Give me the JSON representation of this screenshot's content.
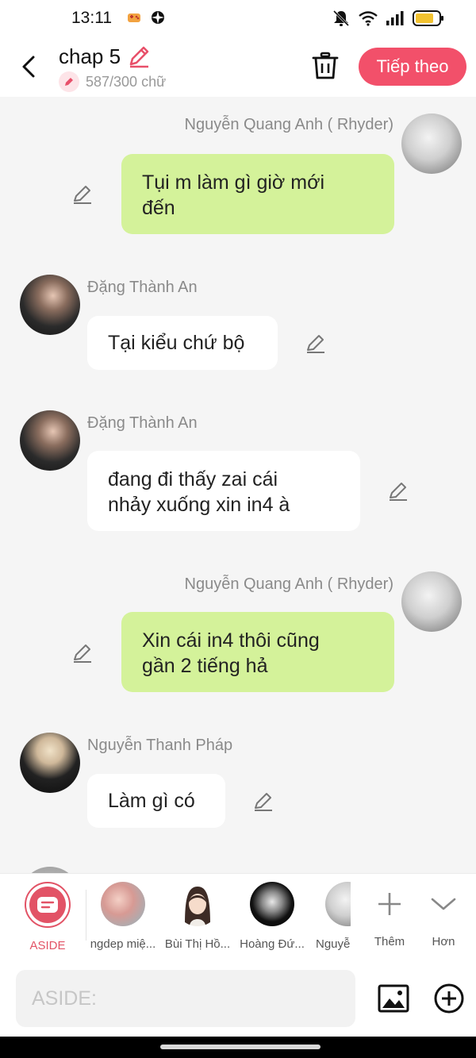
{
  "status_bar": {
    "time": "13:11"
  },
  "header": {
    "title": "chap 5",
    "word_count": "587/300 chữ",
    "next_label": "Tiếp theo"
  },
  "messages": [
    {
      "sender": "Nguyễn Quang Anh ( Rhyder)",
      "side": "right",
      "text_lines": [
        "Tụi m làm gì giờ mới",
        "đến"
      ]
    },
    {
      "sender": "Đặng Thành An",
      "side": "left",
      "text_lines": [
        "Tại kiểu chứ bộ"
      ]
    },
    {
      "sender": "Đặng Thành An",
      "side": "left",
      "text_lines": [
        "đang đi thấy zai cái",
        "nhảy xuống xin in4 à"
      ]
    },
    {
      "sender": "Nguyễn Quang Anh ( Rhyder)",
      "side": "right",
      "text_lines": [
        "Xin cái in4 thôi cũng",
        "gần 2 tiếng hả"
      ]
    },
    {
      "sender": "Nguyễn Thanh Pháp",
      "side": "left",
      "text_lines": [
        "Làm gì có"
      ]
    }
  ],
  "characters": {
    "aside": "ASIDE",
    "items": [
      "ngdep miệ...",
      "Bùi Thị Hồ...",
      "Hoàng Đứ...",
      "Nguyễ"
    ],
    "add_label": "Thêm",
    "more_label": "Hơn"
  },
  "input": {
    "placeholder": "ASIDE:"
  },
  "colors": {
    "accent": "#f2506a",
    "my_bubble": "#d4f29a",
    "aside": "#e25366"
  }
}
